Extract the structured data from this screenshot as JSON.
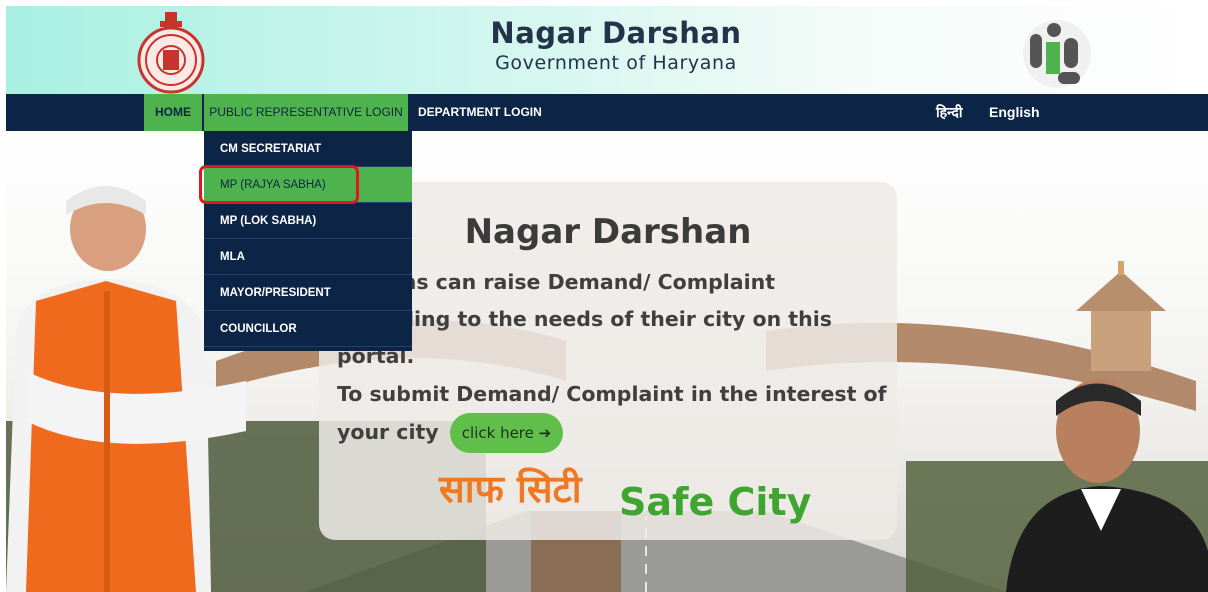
{
  "header": {
    "title": "Nagar Darshan",
    "subtitle": "Government of Haryana",
    "left_emblem": "haryana-emblem-icon",
    "right_logo": "nagar-darshan-logo-icon"
  },
  "nav": {
    "home": "HOME",
    "public_login": "PUBLIC REPRESENTATIVE LOGIN",
    "department_login": "DEPARTMENT LOGIN",
    "hindi": "हिन्दी",
    "english": "English"
  },
  "dropdown": {
    "items": [
      {
        "label": "CM SECRETARIAT"
      },
      {
        "label": "MP (RAJYA SABHA)"
      },
      {
        "label": "MP (LOK SABHA)"
      },
      {
        "label": "MLA"
      },
      {
        "label": "MAYOR/PRESIDENT"
      },
      {
        "label": "COUNCILLOR"
      }
    ],
    "selected": "MP (RAJYA SABHA)"
  },
  "panel": {
    "title": "Nagar Darshan",
    "text1": "Citizens can raise Demand/ Complaint according to the needs of their city on this portal.",
    "text2": "To submit Demand/ Complaint in the interest of your city",
    "button": "click here",
    "safe_city_hindi": "साफ सिटी",
    "safe_city_english": "Safe City"
  },
  "colors": {
    "nav_bg": "#0c2446",
    "accent_green": "#4fb34d",
    "highlight_red": "#e3161e",
    "orange": "#f07820"
  }
}
